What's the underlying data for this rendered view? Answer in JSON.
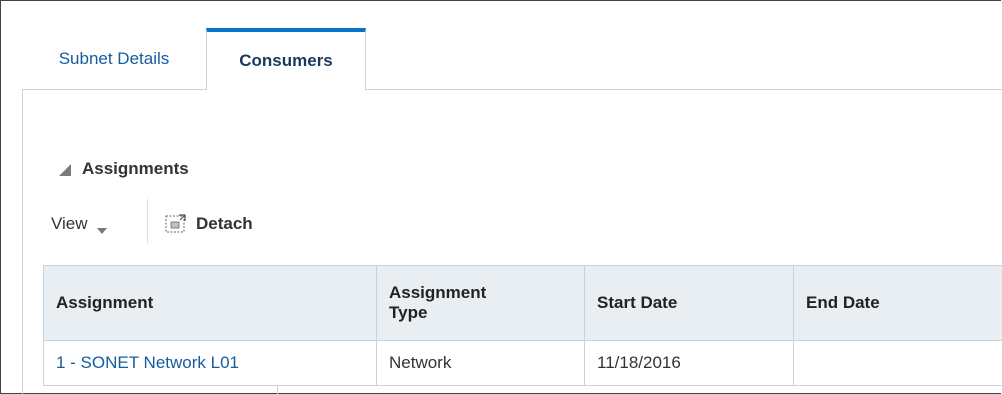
{
  "tabs": [
    {
      "label": "Subnet Details",
      "active": false
    },
    {
      "label": "Consumers",
      "active": true
    }
  ],
  "colors": {
    "accent": "#0a75c8",
    "link": "#145c9e",
    "header_bg": "#e9eef2",
    "border": "#c9d3dc"
  },
  "section": {
    "title": "Assignments",
    "icon": "disclosure-triangle-icon"
  },
  "toolbar": {
    "view_label": "View",
    "view_icon": "chevron-down-icon",
    "detach_label": "Detach",
    "detach_icon": "detach-icon"
  },
  "table": {
    "columns": [
      "Assignment",
      "Assignment Type",
      "Start Date",
      "End Date"
    ],
    "column_lines": [
      [
        "Assignment"
      ],
      [
        "Assignment",
        "Type"
      ],
      [
        "Start Date"
      ],
      [
        "End Date"
      ]
    ],
    "rows": [
      {
        "assignment": "1 - SONET Network L01",
        "type": "Network",
        "start_date": "11/18/2016",
        "end_date": ""
      }
    ]
  }
}
